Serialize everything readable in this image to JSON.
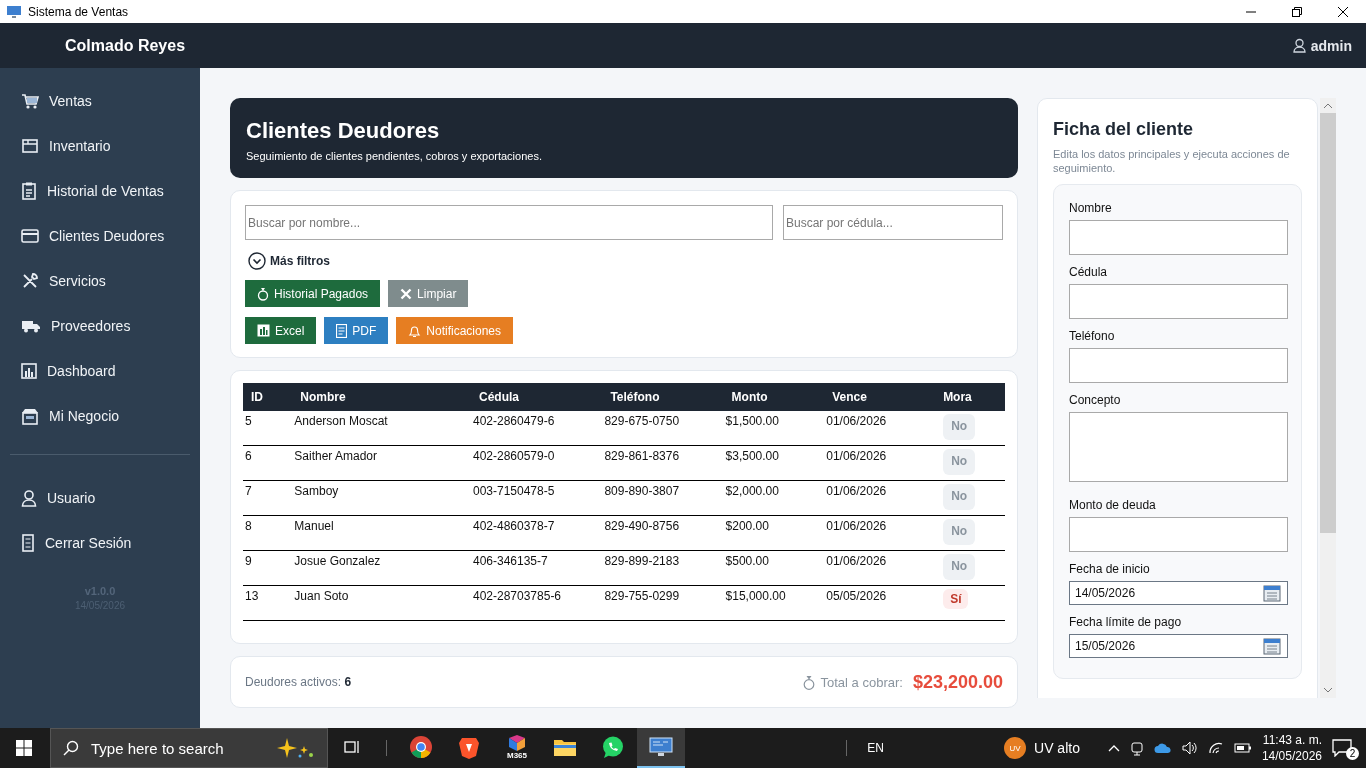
{
  "window": {
    "title": "Sistema de Ventas"
  },
  "header": {
    "brand": "Colmado Reyes",
    "user": "admin"
  },
  "sidebar": {
    "items": [
      {
        "label": "Ventas",
        "kind": "cart"
      },
      {
        "label": "Inventario",
        "kind": "box"
      },
      {
        "label": "Historial de Ventas",
        "kind": "clipboard"
      },
      {
        "label": "Clientes Deudores",
        "kind": "card"
      },
      {
        "label": "Servicios",
        "kind": "tools"
      },
      {
        "label": "Proveedores",
        "kind": "truck"
      },
      {
        "label": "Dashboard",
        "kind": "chart"
      },
      {
        "label": "Mi Negocio",
        "kind": "store"
      }
    ],
    "footer_items": [
      {
        "label": "Usuario",
        "kind": "user"
      },
      {
        "label": "Cerrar Sesión",
        "kind": "door"
      }
    ],
    "version": "v1.0.0",
    "date": "14/05/2026"
  },
  "page": {
    "title": "Clientes Deudores",
    "subtitle": "Seguimiento de clientes pendientes, cobros y exportaciones."
  },
  "filters": {
    "name_search": {
      "placeholder": "Buscar por nombre..."
    },
    "id_search": {
      "placeholder": "Buscar por cédula..."
    },
    "more_filters": {
      "label": "Más filtros",
      "expanded": false
    }
  },
  "actions": [
    [
      {
        "label": "Historial Pagados",
        "kind": "history"
      },
      {
        "label": "Limpiar",
        "kind": "clear"
      }
    ],
    [
      {
        "label": "Excel",
        "kind": "excel"
      },
      {
        "label": "PDF",
        "kind": "pdf"
      },
      {
        "label": "Notificaciones",
        "kind": "notify"
      }
    ]
  ],
  "table": {
    "columns": [
      "ID",
      "Nombre",
      "Cédula",
      "Teléfono",
      "Monto",
      "Vence",
      "Mora"
    ],
    "rows": [
      {
        "cells": [
          "5",
          "Anderson Moscat",
          "402-2860479-6",
          "829-675-0750",
          "$1,500.00",
          "01/06/2026"
        ],
        "mora": "No",
        "overdue": false
      },
      {
        "cells": [
          "6",
          "Saither Amador",
          "402-2860579-0",
          "829-861-8376",
          "$3,500.00",
          "01/06/2026"
        ],
        "mora": "No",
        "overdue": false
      },
      {
        "cells": [
          "7",
          "Samboy",
          "003-7150478-5",
          "809-890-3807",
          "$2,000.00",
          "01/06/2026"
        ],
        "mora": "No",
        "overdue": false
      },
      {
        "cells": [
          "8",
          "Manuel",
          "402-4860378-7",
          "829-490-8756",
          "$200.00",
          "01/06/2026"
        ],
        "mora": "No",
        "overdue": false
      },
      {
        "cells": [
          "9",
          "Josue Gonzalez",
          "406-346135-7",
          "829-899-2183",
          "$500.00",
          "01/06/2026"
        ],
        "mora": "No",
        "overdue": false
      },
      {
        "cells": [
          "13",
          "Juan Soto",
          "402-28703785-6",
          "829-755-0299",
          "$15,000.00",
          "05/05/2026"
        ],
        "mora": "Sí",
        "overdue": true
      }
    ]
  },
  "summary": {
    "active_label": "Deudores activos:",
    "active_count": "6",
    "total_label": "Total a cobrar:",
    "total": "$23,200.00"
  },
  "form": {
    "title": "Ficha del cliente",
    "subtitle": "Edita los datos principales y ejecuta acciones de seguimiento.",
    "fields": [
      {
        "label": "Nombre",
        "kind": "text"
      },
      {
        "label": "Cédula",
        "kind": "text"
      },
      {
        "label": "Teléfono",
        "kind": "text"
      },
      {
        "label": "Concepto",
        "kind": "textarea"
      },
      {
        "label": "Monto de deuda",
        "kind": "text"
      },
      {
        "label": "Fecha de inicio",
        "kind": "date",
        "value": "14/05/2026"
      },
      {
        "label": "Fecha límite de pago",
        "kind": "date",
        "value": "15/05/2026"
      }
    ]
  },
  "taskbar": {
    "search": {
      "placeholder": "Type here to search"
    },
    "apps": [
      {
        "kind": "taskview",
        "selected": false
      },
      {
        "kind": "chrome",
        "selected": false
      },
      {
        "kind": "brave",
        "selected": false
      },
      {
        "kind": "m365",
        "label": "M365",
        "selected": false
      },
      {
        "kind": "folder",
        "selected": false
      },
      {
        "kind": "whatsapp",
        "selected": false
      },
      {
        "kind": "monitor",
        "selected": true
      }
    ],
    "language": "EN",
    "weather": {
      "badge": "UV",
      "text": "UV alto"
    },
    "time": "11:43 a. m.",
    "date": "14/05/2026",
    "notifications": "2"
  }
}
